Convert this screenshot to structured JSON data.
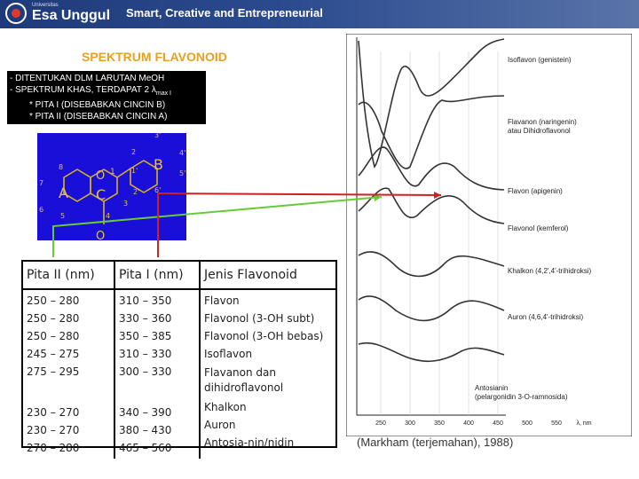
{
  "header": {
    "logo_small": "Universitas",
    "logo_name": "Esa Unggul",
    "tagline": "Smart, Creative and Entrepreneurial"
  },
  "title": "SPEKTRUM FLAVONOID",
  "notes": {
    "line1": "- DITENTUKAN DLM LARUTAN MeOH",
    "line2_prefix": "- SPEKTRUM KHAS, TERDAPAT 2 λ",
    "line2_sub": "max I",
    "line3": "* PITA I (DISEBABKAN CINCIN B)",
    "line4": "* PITA II (DISEBABKAN CINCIN A)"
  },
  "structure": {
    "ring_a": "A",
    "ring_b": "B",
    "ring_c": "C",
    "o1": "O",
    "o1_num": "1",
    "o_carbonyl": "O",
    "n2": "2",
    "n3": "3",
    "n4": "4",
    "n5": "5",
    "n6": "6",
    "n7": "7",
    "n8": "8",
    "n1p": "1'",
    "n2p": "2'",
    "n3p": "3'",
    "n4p": "4'",
    "n5p": "5'",
    "n6p": "6'"
  },
  "table": {
    "headers": [
      "Pita II (nm)",
      "Pita I (nm)",
      "Jenis Flavonoid"
    ],
    "group1": {
      "pita2": [
        "250 – 280",
        "250 – 280",
        "250 – 280",
        "245 – 275",
        "275 – 295"
      ],
      "pita1": [
        "310 – 350",
        "330 – 360",
        "350 – 385",
        "310 – 330",
        "300 – 330"
      ],
      "jenis": [
        "Flavon",
        "Flavonol (3-OH subt)",
        "Flavonol (3-OH bebas)",
        "Isoflavon",
        "Flavanon dan",
        "dihidroflavonol"
      ]
    },
    "group2": {
      "pita2": [
        "230 – 270",
        "230 – 270",
        "270 – 280"
      ],
      "pita1": [
        "340 – 390",
        "380 – 430",
        "465 – 560"
      ],
      "jenis": [
        "Khalkon",
        "Auron",
        "Antosia-nin/nidin"
      ]
    }
  },
  "spectrum": {
    "labels": {
      "isoflavon": "Isoflavon (genistein)",
      "flavanon1": "Flavanon (naringenin)",
      "flavanon2": "atau Dihidroflavonol",
      "flavon": "Flavon (apigenin)",
      "flavonol": "Flavonol (kemferol)",
      "khalkon": "Khalkon (4,2',4'-trihidroksi)",
      "auron": "Auron (4,6,4'-trihidroksi)",
      "antosianin1": "Antosianin",
      "antosianin2": "(pelargonidin 3-O-ramnosida)"
    },
    "x_ticks": [
      "250",
      "300",
      "350",
      "400",
      "450",
      "500",
      "550"
    ],
    "x_unit": "λ, nm"
  },
  "caption": "(Markham (terjemahan), 1988)",
  "colors": {
    "arrow_green": "#66cc33",
    "arrow_red": "#cc2222",
    "title": "#e8a020",
    "structure_bg": "#1a0fd8"
  }
}
